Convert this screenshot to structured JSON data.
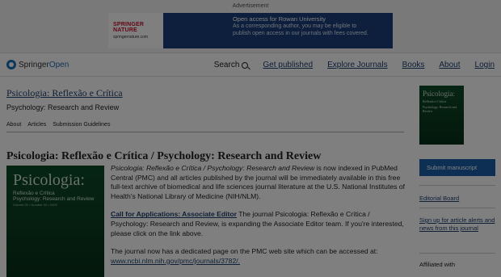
{
  "ad": {
    "label": "Advertisement",
    "brand": "SPRINGER NATURE",
    "site": "springernature.com",
    "line1": "Open access for Rowan University",
    "line2": "As a corresponding author, you may be eligible to",
    "line3": "publish open access in our journals with fees covered."
  },
  "header": {
    "logo_prefix": "Springer",
    "logo_suffix": "Open",
    "nav": {
      "search": "Search",
      "get_published": "Get published",
      "explore": "Explore Journals",
      "books": "Books",
      "about": "About",
      "login": "Login"
    }
  },
  "journal": {
    "title": "Psicologia: Reflexão e Crítica",
    "subtitle": "Psychology: Research and Review",
    "tabs": [
      "About",
      "Articles",
      "Submission Guidelines"
    ],
    "cover_title": "Psicologia:",
    "cover_sub1": "Reflexão e Crítica",
    "cover_sub2": "Psychology: Research and Review"
  },
  "main": {
    "heading": "Psicologia: Reflexão e Crítica / Psychology: Research and Review",
    "cover_title": "Psicologia:",
    "cover_sub1": "Reflexão e Crítica",
    "cover_sub2": "Psychology: Research and Review",
    "cover_sub3": "Volume 00 • Number 00 • 0000",
    "p1_italic": "Psicologia: Reflexão e Crítica / Psychology: Research and Review",
    "p1_rest": " is now indexed in PubMed Central (PMC) and all articles published by the journal will be immediately available in this free full-text archive of biomedical and life sciences journal literature at the U.S. National Institutes of Health's National Library of Medicine (NIH/NLM).",
    "p2_link": "Call for Applications: Associate Editor",
    "p2_rest": " The journal Psicologia: Reflexão e Crítica / Psychology: Research and Review, is expanding the Associate Editor team. If you're interested, please click on the link above.",
    "p3_text": "The journal now has a dedicated page on the PMC web site which can be accessed at:",
    "p3_link": "www.ncbi.nlm.nih.gov/pmc/journals/3782/."
  },
  "sidebar": {
    "submit": "Submit manuscript",
    "editorial_board": "Editorial Board",
    "alerts": "Sign up for article alerts and news from this journal",
    "affiliated": "Affiliated with"
  }
}
